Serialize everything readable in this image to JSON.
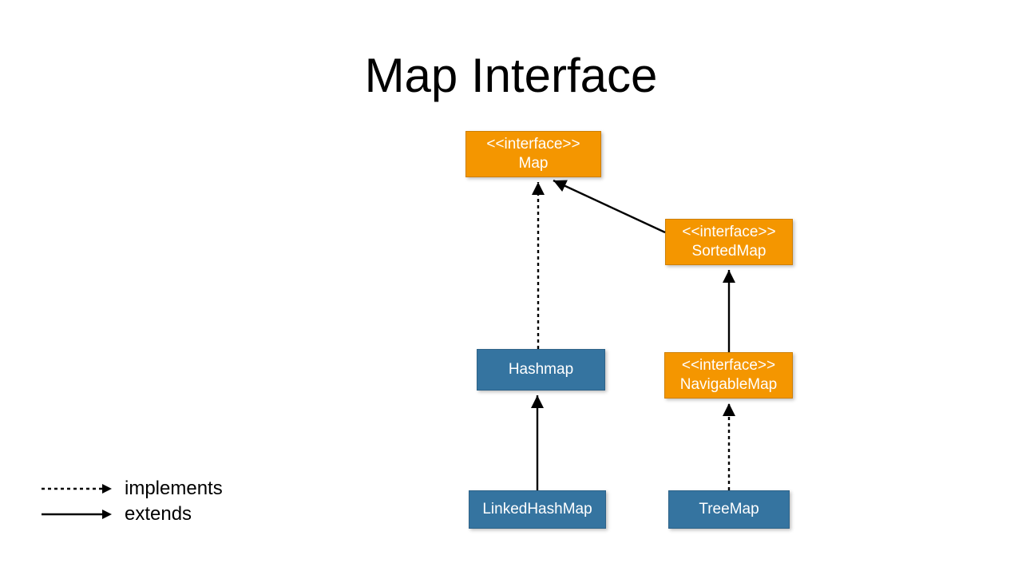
{
  "title": "Map Interface",
  "nodes": {
    "map": {
      "stereo": "<<interface>>",
      "name": "Map",
      "kind": "interface"
    },
    "sortedmap": {
      "stereo": "<<interface>>",
      "name": "SortedMap",
      "kind": "interface"
    },
    "navigablemap": {
      "stereo": "<<interface>>",
      "name": "NavigableMap",
      "kind": "interface"
    },
    "hashmap": {
      "name": "Hashmap",
      "kind": "class"
    },
    "linkedhashmap": {
      "name": "LinkedHashMap",
      "kind": "class"
    },
    "treemap": {
      "name": "TreeMap",
      "kind": "class"
    }
  },
  "edges": [
    {
      "from": "hashmap",
      "to": "map",
      "rel": "implements"
    },
    {
      "from": "sortedmap",
      "to": "map",
      "rel": "extends"
    },
    {
      "from": "linkedhashmap",
      "to": "hashmap",
      "rel": "extends"
    },
    {
      "from": "navigablemap",
      "to": "sortedmap",
      "rel": "extends"
    },
    {
      "from": "treemap",
      "to": "navigablemap",
      "rel": "implements"
    }
  ],
  "legend": {
    "implements": "implements",
    "extends": "extends"
  }
}
